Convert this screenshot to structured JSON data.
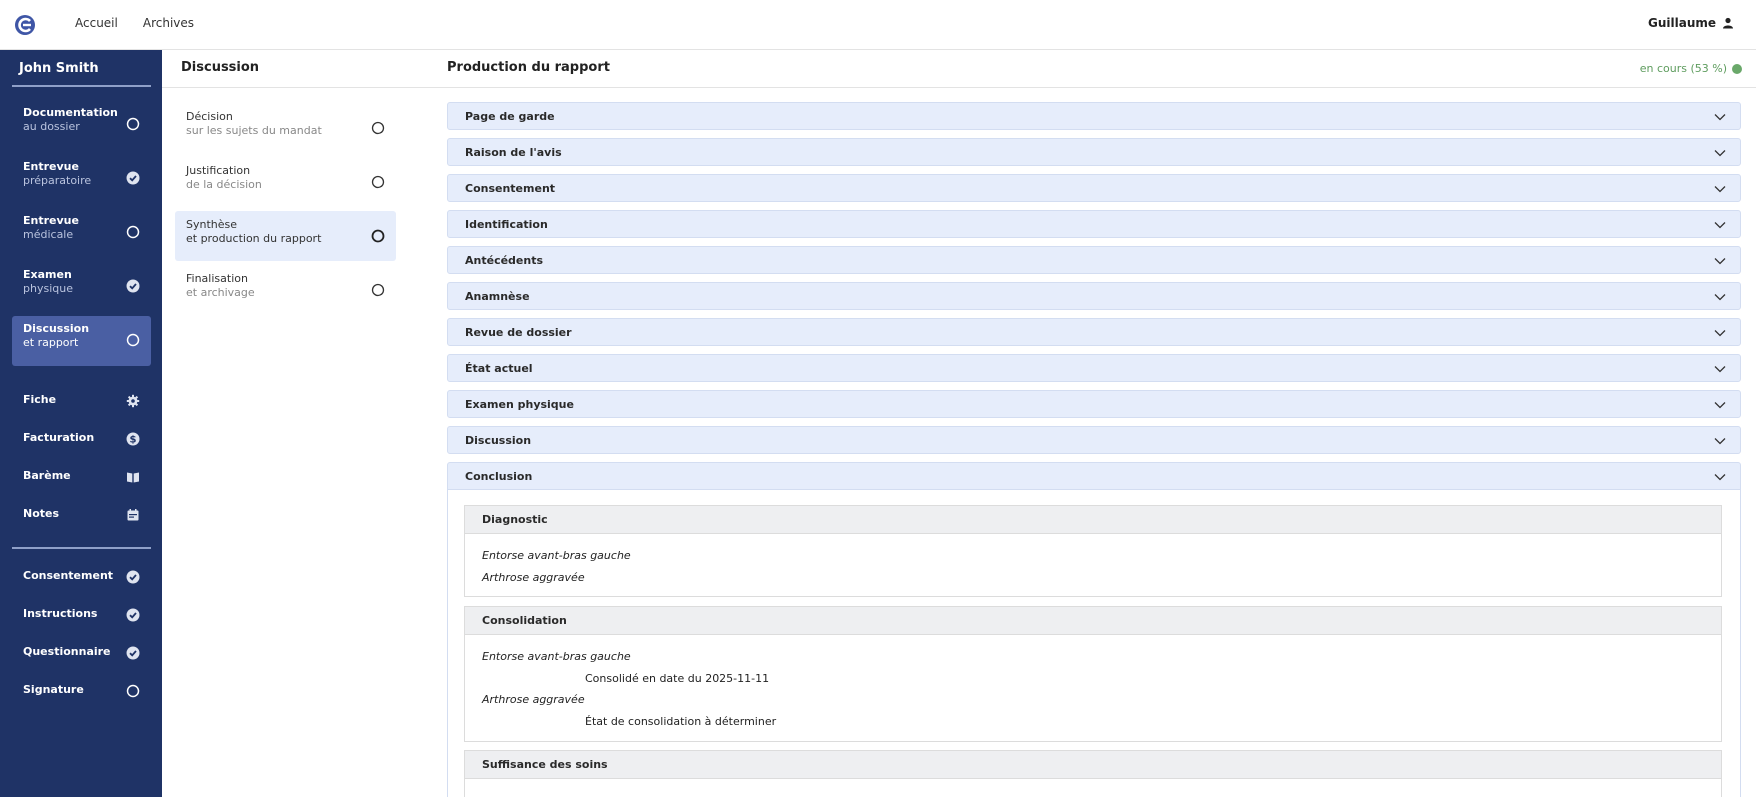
{
  "topbar": {
    "nav": [
      "Accueil",
      "Archives"
    ],
    "user": "Guillaume"
  },
  "sidebar": {
    "patient": "John Smith",
    "steps": [
      {
        "l1": "Documentation",
        "l2": "au dossier",
        "status": "open"
      },
      {
        "l1": "Entrevue",
        "l2": "préparatoire",
        "status": "done"
      },
      {
        "l1": "Entrevue",
        "l2": "médicale",
        "status": "open"
      },
      {
        "l1": "Examen",
        "l2": "physique",
        "status": "done"
      },
      {
        "l1": "Discussion",
        "l2": "et rapport",
        "status": "open",
        "active": true
      }
    ],
    "menu": [
      {
        "label": "Fiche",
        "icon": "gear-icon"
      },
      {
        "label": "Facturation",
        "icon": "dollar-icon"
      },
      {
        "label": "Barème",
        "icon": "book-icon"
      },
      {
        "label": "Notes",
        "icon": "calendar-icon"
      }
    ],
    "checks": [
      {
        "label": "Consentement",
        "status": "done"
      },
      {
        "label": "Instructions",
        "status": "done"
      },
      {
        "label": "Questionnaire",
        "status": "done"
      },
      {
        "label": "Signature",
        "status": "open"
      }
    ]
  },
  "middle": {
    "title": "Discussion",
    "substeps": [
      {
        "l1": "Décision",
        "l2": "sur les sujets du mandat"
      },
      {
        "l1": "Justification",
        "l2": "de la décision"
      },
      {
        "l1": "Synthèse",
        "l2": "et production du rapport",
        "active": true
      },
      {
        "l1": "Finalisation",
        "l2": "et archivage"
      }
    ]
  },
  "right": {
    "title": "Production du rapport",
    "status": "en cours (53 %)",
    "status_color": "#6aa86a",
    "sections": [
      "Page de garde",
      "Raison de l'avis",
      "Consentement",
      "Identification",
      "Antécédents",
      "Anamnèse",
      "Revue de dossier",
      "État actuel",
      "Examen physique",
      "Discussion",
      "Conclusion"
    ],
    "conclusion": {
      "diagnostic": {
        "title": "Diagnostic",
        "items": [
          "Entorse avant-bras gauche",
          "Arthrose aggravée"
        ]
      },
      "consolidation": {
        "title": "Consolidation",
        "item1": "Entorse avant-bras gauche",
        "item1_detail": "Consolidé en date du 2025-11-11",
        "item2": "Arthrose aggravée",
        "item2_detail": "État de consolidation à déterminer"
      },
      "suffisance": {
        "title": "Suffisance des soins"
      }
    }
  },
  "colors": {
    "sidebar": "#1f3366",
    "sidebar_active": "#4a5fa3",
    "accordion": "#e6edfb"
  }
}
